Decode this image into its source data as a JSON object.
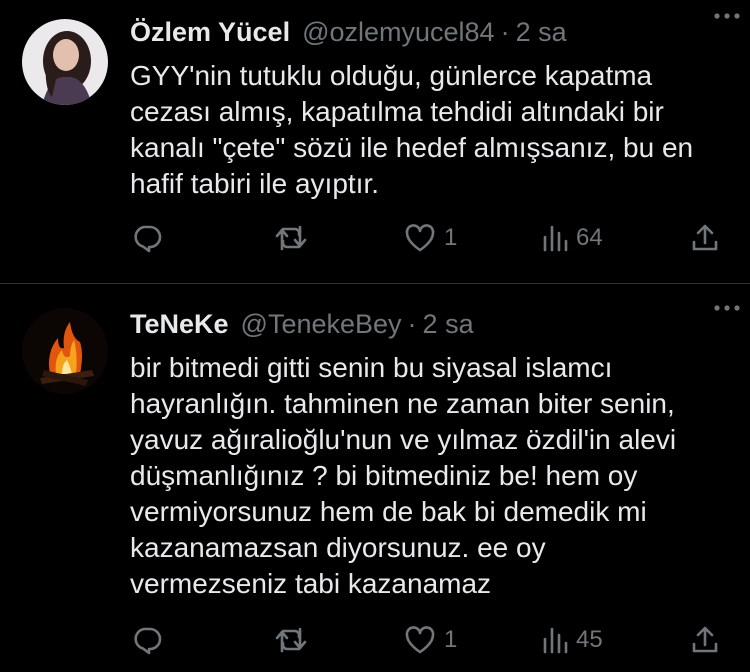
{
  "tweets": [
    {
      "name": "Özlem Yücel",
      "handle": "@ozlemyucel84",
      "separator": "·",
      "time": "2 sa",
      "lines": [
        "GYY'nin tutuklu olduğu, günlerce kapatma",
        "cezası almış, kapatılma tehdidi altındaki bir",
        "kanalı \"çete\" sözü ile hedef almışsanız, bu en",
        "hafif tabiri ile ayıptır."
      ],
      "likes": "1",
      "views": "64"
    },
    {
      "name": "TeNeKe",
      "handle": "@TenekeBey",
      "separator": "·",
      "time": "2 sa",
      "lines": [
        "bir bitmedi gitti senin bu siyasal islamcı",
        "hayranlığın. tahminen ne zaman biter senin,",
        "yavuz ağıralioğlu'nun ve yılmaz özdil'in alevi",
        "düşmanlığınız ? bi bitmediniz be! hem oy",
        "vermiyorsunuz hem de bak bi demedik mi",
        "kazanamazsan diyorsunuz. ee oy",
        "vermezseniz tabi kazanamaz"
      ],
      "likes": "1",
      "views": "45"
    }
  ],
  "icons": {
    "reply": "reply-icon",
    "retweet": "retweet-icon",
    "like": "heart-icon",
    "views": "views-icon",
    "share": "share-icon",
    "more": "more-icon"
  },
  "colors": {
    "background": "#000000",
    "text": "#e7e9ea",
    "muted": "#71767b",
    "divider": "#2f3336"
  }
}
